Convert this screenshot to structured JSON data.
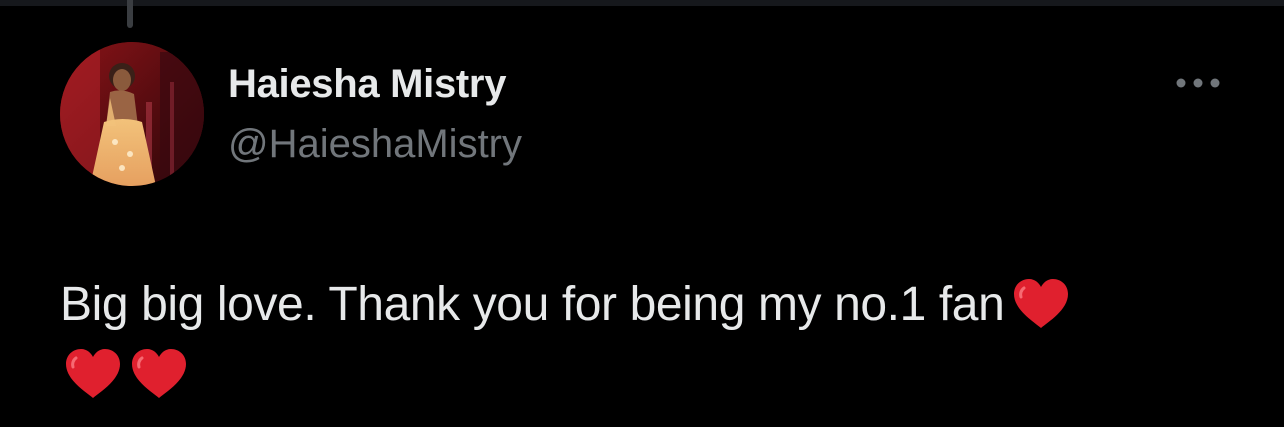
{
  "tweet": {
    "author": {
      "display_name": "Haiesha Mistry",
      "handle": "@HaieshaMistry"
    },
    "text_main": "Big big love. Thank you for being my no.1 fan",
    "emojis": [
      "heart",
      "heart",
      "heart"
    ],
    "more_icon": "more-horizontal-icon"
  },
  "colors": {
    "background": "#000000",
    "primary_text": "#e7e9ea",
    "secondary_text": "#71767b",
    "heart": "#e0202e"
  }
}
